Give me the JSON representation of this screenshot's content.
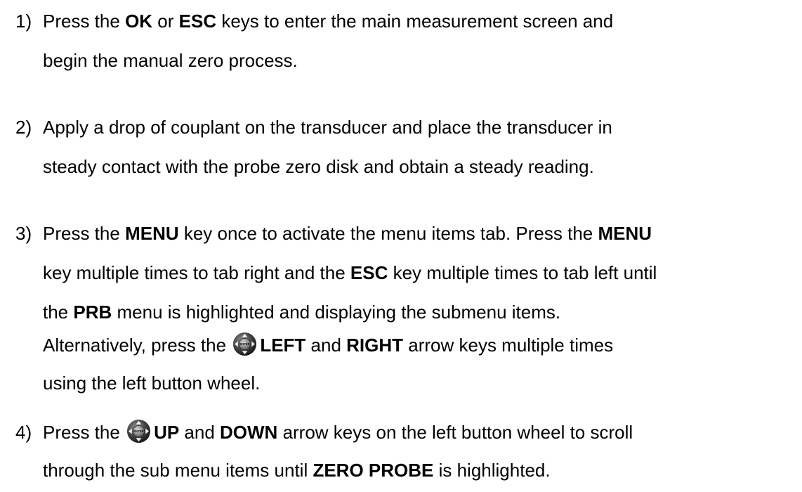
{
  "steps": [
    {
      "number": "1)",
      "lines": [
        [
          "Press the ",
          "OK",
          " or ",
          "ESC",
          " keys to enter the main measurement screen and"
        ],
        [
          "begin the manual zero process."
        ]
      ]
    },
    {
      "number": "2)",
      "lines": [
        [
          "Apply a drop of couplant on the transducer and place the transducer in"
        ],
        [
          "steady contact with the probe zero disk and obtain a steady reading."
        ]
      ]
    },
    {
      "number": "3)",
      "lines": [
        [
          "Press the ",
          "MENU",
          " key once to activate the menu items tab.  Press the ",
          "MENU"
        ],
        [
          "key multiple times to tab right and the ",
          "ESC",
          " key multiple times to tab left until"
        ],
        [
          "the ",
          "PRB",
          " menu is highlighted and displaying the submenu items."
        ],
        [
          "Alternatively, press the ",
          "LEFT",
          " and ",
          "RIGHT",
          " arrow keys multiple times"
        ],
        [
          "using the left button wheel."
        ]
      ]
    },
    {
      "number": "4)",
      "lines": [
        [
          "Press the ",
          "UP",
          " and ",
          "DOWN",
          " arrow keys on the left button wheel to scroll"
        ],
        [
          "through the sub menu items until ",
          "ZERO PROBE",
          " is highlighted."
        ]
      ]
    }
  ],
  "icons": {
    "button_wheel": "button-wheel-icon",
    "center_label": "ENTER"
  }
}
